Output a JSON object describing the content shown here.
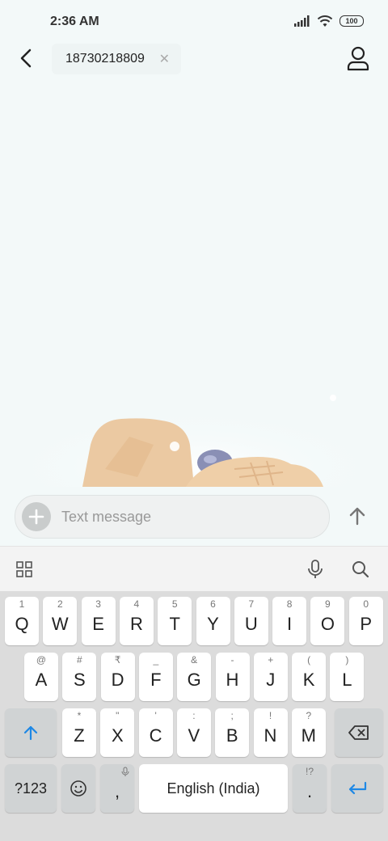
{
  "status": {
    "time": "2:36 AM",
    "battery": "100"
  },
  "header": {
    "recipient": "18730218809"
  },
  "compose": {
    "placeholder": "Text message"
  },
  "keyboard": {
    "row1": [
      {
        "hint": "1",
        "key": "Q"
      },
      {
        "hint": "2",
        "key": "W"
      },
      {
        "hint": "3",
        "key": "E"
      },
      {
        "hint": "4",
        "key": "R"
      },
      {
        "hint": "5",
        "key": "T"
      },
      {
        "hint": "6",
        "key": "Y"
      },
      {
        "hint": "7",
        "key": "U"
      },
      {
        "hint": "8",
        "key": "I"
      },
      {
        "hint": "9",
        "key": "O"
      },
      {
        "hint": "0",
        "key": "P"
      }
    ],
    "row2": [
      {
        "hint": "@",
        "key": "A"
      },
      {
        "hint": "#",
        "key": "S"
      },
      {
        "hint": "₹",
        "key": "D"
      },
      {
        "hint": "_",
        "key": "F"
      },
      {
        "hint": "&",
        "key": "G"
      },
      {
        "hint": "-",
        "key": "H"
      },
      {
        "hint": "+",
        "key": "J"
      },
      {
        "hint": "(",
        "key": "K"
      },
      {
        "hint": ")",
        "key": "L"
      }
    ],
    "row3": [
      {
        "hint": "*",
        "key": "Z"
      },
      {
        "hint": "\"",
        "key": "X"
      },
      {
        "hint": "'",
        "key": "C"
      },
      {
        "hint": ":",
        "key": "V"
      },
      {
        "hint": ";",
        "key": "B"
      },
      {
        "hint": "!",
        "key": "N"
      },
      {
        "hint": "?",
        "key": "M"
      }
    ],
    "symbols_label": "?123",
    "comma": ",",
    "space_label": "English (India)",
    "period": ".",
    "period_hint": "!?"
  }
}
